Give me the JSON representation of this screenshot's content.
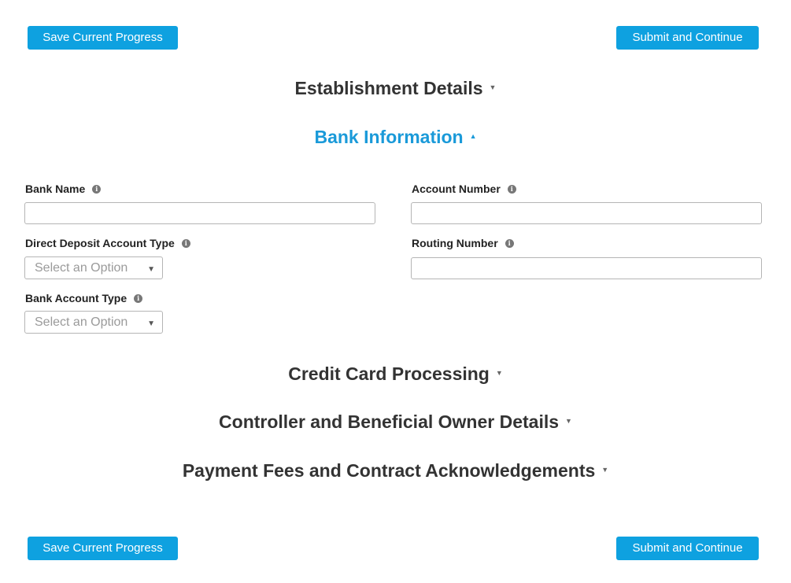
{
  "buttons": {
    "save_label": "Save Current Progress",
    "submit_label": "Submit and Continue"
  },
  "sections": {
    "establishment": {
      "title": "Establishment Details",
      "expanded": false
    },
    "bank": {
      "title": "Bank Information",
      "expanded": true
    },
    "credit_card": {
      "title": "Credit Card Processing",
      "expanded": false
    },
    "controller": {
      "title": "Controller and Beneficial Owner Details",
      "expanded": false
    },
    "payment_fees": {
      "title": "Payment Fees and Contract Acknowledgements",
      "expanded": false
    }
  },
  "bank_form": {
    "bank_name": {
      "label": "Bank Name",
      "value": ""
    },
    "account_number": {
      "label": "Account Number",
      "value": ""
    },
    "direct_deposit_type": {
      "label": "Direct Deposit Account Type",
      "placeholder": "Select an Option"
    },
    "routing_number": {
      "label": "Routing Number",
      "value": ""
    },
    "bank_account_type": {
      "label": "Bank Account Type",
      "placeholder": "Select an Option"
    }
  },
  "colors": {
    "primary_button": "#0ea1e0",
    "active_section": "#1a9ad9",
    "text": "#333333"
  },
  "icons": {
    "info": "info-circle-icon",
    "collapsed": "caret-down-icon",
    "expanded": "caret-up-icon",
    "dropdown": "caret-down-icon"
  }
}
